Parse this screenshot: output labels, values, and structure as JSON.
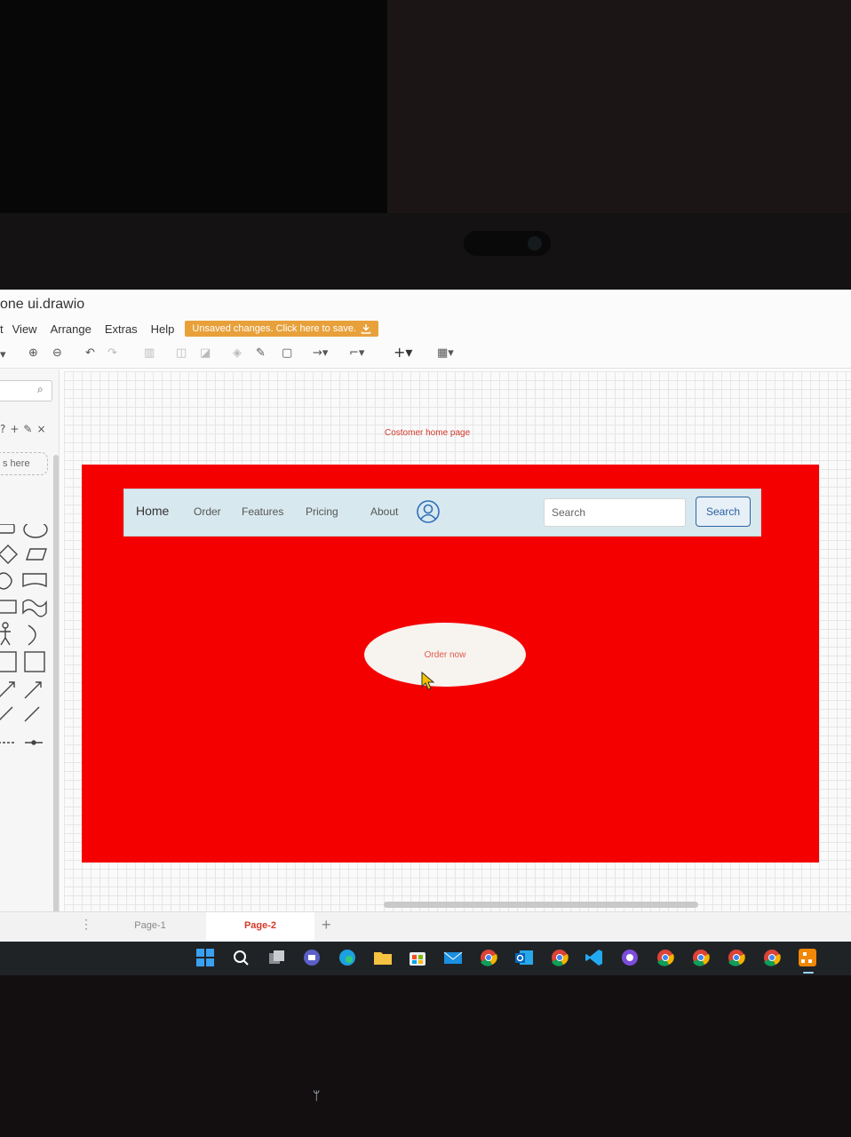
{
  "app": {
    "title": "one ui.drawio"
  },
  "menubar": {
    "items": [
      "t",
      "View",
      "Arrange",
      "Extras",
      "Help"
    ],
    "unsaved_button": "Unsaved changes. Click here to save."
  },
  "sidebar": {
    "drop_placeholder": "s here"
  },
  "diagram": {
    "page_label": "Costomer home page",
    "navbar": {
      "links": [
        "Home",
        "Order",
        "Features",
        "Pricing",
        "About"
      ],
      "search_placeholder": "Search",
      "search_button": "Search"
    },
    "order_button": "Order now"
  },
  "pages": {
    "tabs": [
      "Page-1",
      "Page-2"
    ],
    "active": "Page-2"
  },
  "colors": {
    "frame_red": "#f40000",
    "navbar_bg": "#d8e8ef",
    "unsaved_orange": "#e8a13a",
    "active_tab": "#d43a2a"
  },
  "taskbar": {
    "icons": [
      "windows-start-icon",
      "search-icon",
      "task-view-icon",
      "teams-icon",
      "edge-icon",
      "file-explorer-icon",
      "store-icon",
      "mail-icon",
      "chrome-icon",
      "outlook-icon",
      "chrome-icon",
      "vscode-icon",
      "github-desktop-icon",
      "chrome-icon",
      "chrome-icon",
      "chrome-icon",
      "chrome-icon",
      "drawio-icon"
    ]
  }
}
